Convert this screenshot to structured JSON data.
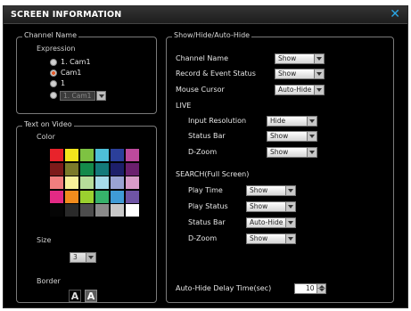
{
  "window": {
    "title": "SCREEN INFORMATION",
    "close_icon": "close-icon"
  },
  "channel_name": {
    "legend": "Channel Name",
    "expression_label": "Expression",
    "options": [
      "1. Cam1",
      "Cam1",
      "1",
      "1. Cam1"
    ],
    "selected_index": 1
  },
  "text_on_video": {
    "legend": "Text on Video",
    "color_label": "Color",
    "palette": [
      [
        "#e8232b",
        "#f3e51c",
        "#7ec242",
        "#4ebfd8",
        "#2b3f9a",
        "#bd4a9c"
      ],
      [
        "#7d1a1a",
        "#7b7a2a",
        "#148a4a",
        "#137a7a",
        "#1d1f6a",
        "#6b1f6e"
      ],
      [
        "#f07e7e",
        "#f7f19a",
        "#b7de9a",
        "#a6dbe9",
        "#9aa3d3",
        "#d99cc9"
      ],
      [
        "#e32a85",
        "#f28c1d",
        "#9bd12f",
        "#36b26b",
        "#3f9bd6",
        "#6f54a5"
      ],
      [
        "#050505",
        "#2a2a2a",
        "#4d4d4d",
        "#8a8a8a",
        "#c8c8c8",
        "#ffffff"
      ]
    ],
    "size_label": "Size",
    "size_value": "3",
    "border_label": "Border",
    "border_options": [
      "A",
      "A"
    ]
  },
  "show_hide": {
    "legend": "Show/Hide/Auto-Hide",
    "rows": [
      {
        "label": "Channel Name",
        "value": "Show"
      },
      {
        "label": "Record & Event Status",
        "value": "Show"
      },
      {
        "label": "Mouse Cursor",
        "value": "Auto-Hide"
      }
    ],
    "live_label": "LIVE",
    "live_rows": [
      {
        "label": "Input Resolution",
        "value": "Hide"
      },
      {
        "label": "Status Bar",
        "value": "Show"
      },
      {
        "label": "D-Zoom",
        "value": "Show"
      }
    ],
    "search_label": "SEARCH(Full Screen)",
    "search_rows": [
      {
        "label": "Play Time",
        "value": "Show"
      },
      {
        "label": "Play Status",
        "value": "Show"
      },
      {
        "label": "Status Bar",
        "value": "Auto-Hide"
      },
      {
        "label": "D-Zoom",
        "value": "Show"
      }
    ],
    "auto_hide_delay_label": "Auto-Hide Delay Time(sec)",
    "auto_hide_delay_value": "10"
  },
  "colors": {
    "radio_selected": "#e35a2a",
    "close_accent": "#2aa7e6"
  }
}
